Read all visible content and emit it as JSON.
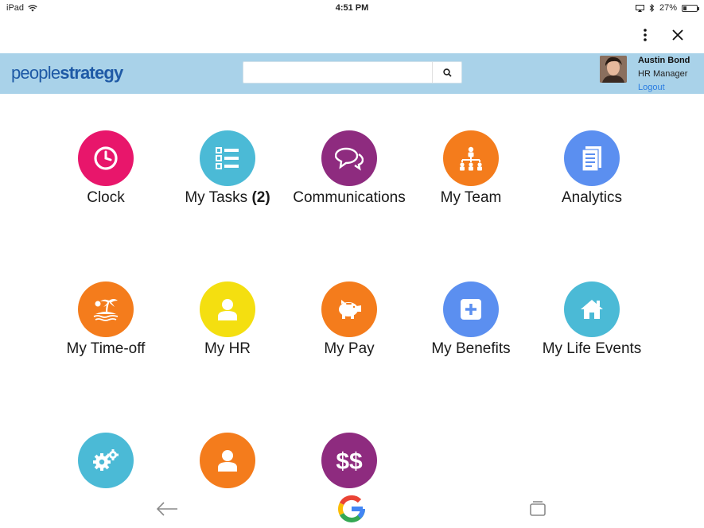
{
  "status_bar": {
    "device": "iPad",
    "time": "4:51 PM",
    "battery_percent": "27%",
    "battery_level": 0.27,
    "icons": [
      "wifi-icon",
      "screen-mirror-icon",
      "bluetooth-icon",
      "battery-icon"
    ]
  },
  "browser": {
    "icons": [
      "more-vertical-icon",
      "close-icon"
    ]
  },
  "header": {
    "brand_part1": "people",
    "brand_part2": "strategy",
    "search_placeholder": "",
    "search_icon": "search-icon",
    "user": {
      "name": "Austin Bond",
      "role": "HR Manager",
      "logout_label": "Logout"
    }
  },
  "tiles": [
    {
      "label": "Clock",
      "badge": "",
      "color": "#e8166b",
      "icon": "clock-icon"
    },
    {
      "label": "My Tasks",
      "badge": "(2)",
      "color": "#4bbad6",
      "icon": "task-list-icon"
    },
    {
      "label": "Communications",
      "badge": "",
      "color": "#8e2b7f",
      "icon": "chat-bubbles-icon"
    },
    {
      "label": "My Team",
      "badge": "",
      "color": "#f47c1c",
      "icon": "org-chart-icon"
    },
    {
      "label": "Analytics",
      "badge": "",
      "color": "#5b8ff0",
      "icon": "report-icon"
    },
    {
      "label": "My Time-off",
      "badge": "",
      "color": "#f47c1c",
      "icon": "island-icon"
    },
    {
      "label": "My HR",
      "badge": "",
      "color": "#f4df10",
      "icon": "person-icon"
    },
    {
      "label": "My Pay",
      "badge": "",
      "color": "#f47c1c",
      "icon": "piggy-bank-icon"
    },
    {
      "label": "My Benefits",
      "badge": "",
      "color": "#5b8ff0",
      "icon": "plus-icon"
    },
    {
      "label": "My Life Events",
      "badge": "",
      "color": "#4bbad6",
      "icon": "home-icon"
    },
    {
      "label": "",
      "badge": "",
      "color": "#4bbad6",
      "icon": "gears-icon"
    },
    {
      "label": "",
      "badge": "",
      "color": "#f47c1c",
      "icon": "person-icon"
    },
    {
      "label": "",
      "badge": "",
      "color": "#8e2b7f",
      "icon": "dollar-icon"
    }
  ],
  "bottom_nav": {
    "icons": [
      "back-arrow-icon",
      "google-icon",
      "tabs-icon"
    ]
  }
}
